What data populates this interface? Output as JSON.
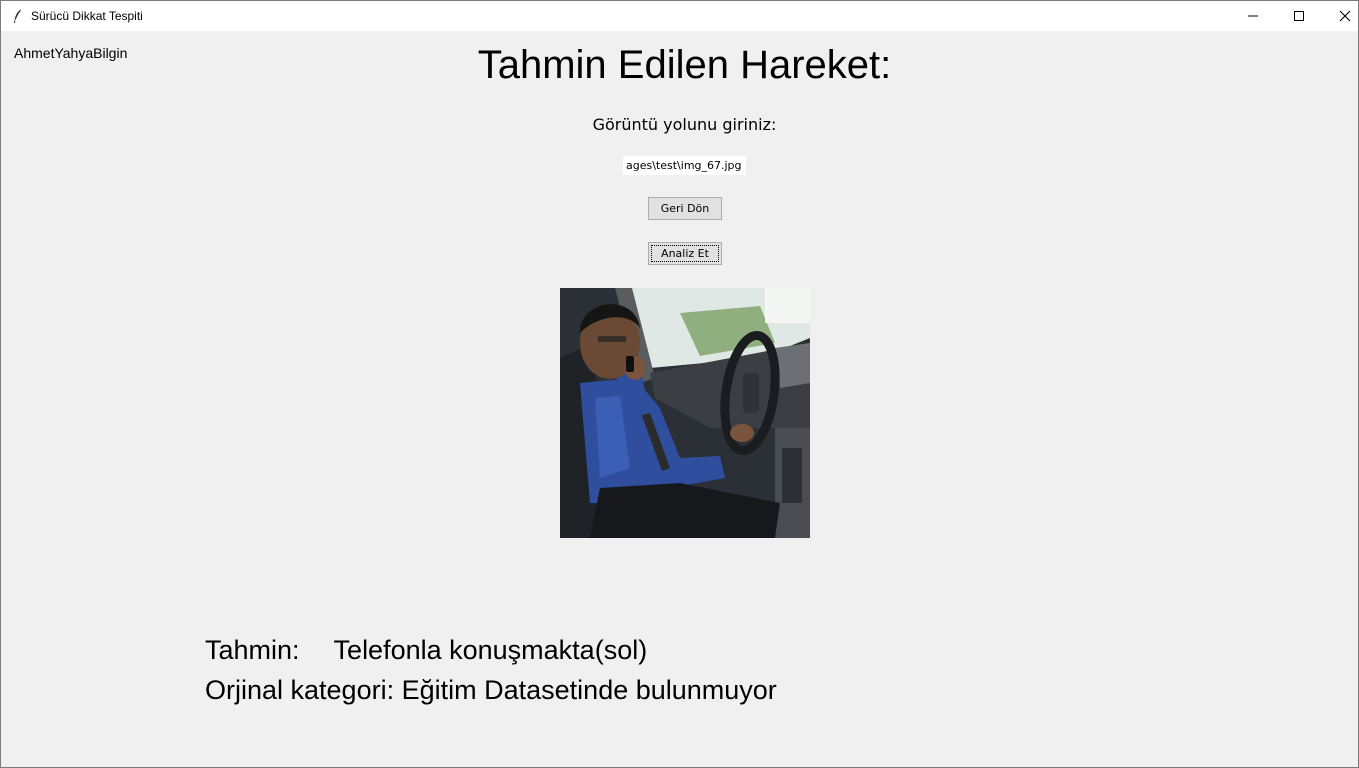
{
  "window": {
    "title": "Sürücü Dikkat Tespiti"
  },
  "app": {
    "author": "AhmetYahyaBilgin",
    "heading": "Tahmin Edilen Hareket:",
    "path_label": "Görüntü yolunu giriniz:",
    "path_value": "ages\\test\\img_67.jpg",
    "back_button": "Geri Dön",
    "analyze_button": "Analiz Et"
  },
  "result": {
    "prediction_label": "Tahmin:",
    "prediction_value": "Telefonla konuşmakta(sol)",
    "category_label": "Orjinal kategori:",
    "category_value": "Eğitim Datasetinde bulunmuyor"
  },
  "icons": {
    "app": "feather-icon",
    "minimize": "minimize-icon",
    "maximize": "maximize-icon",
    "close": "close-icon"
  }
}
